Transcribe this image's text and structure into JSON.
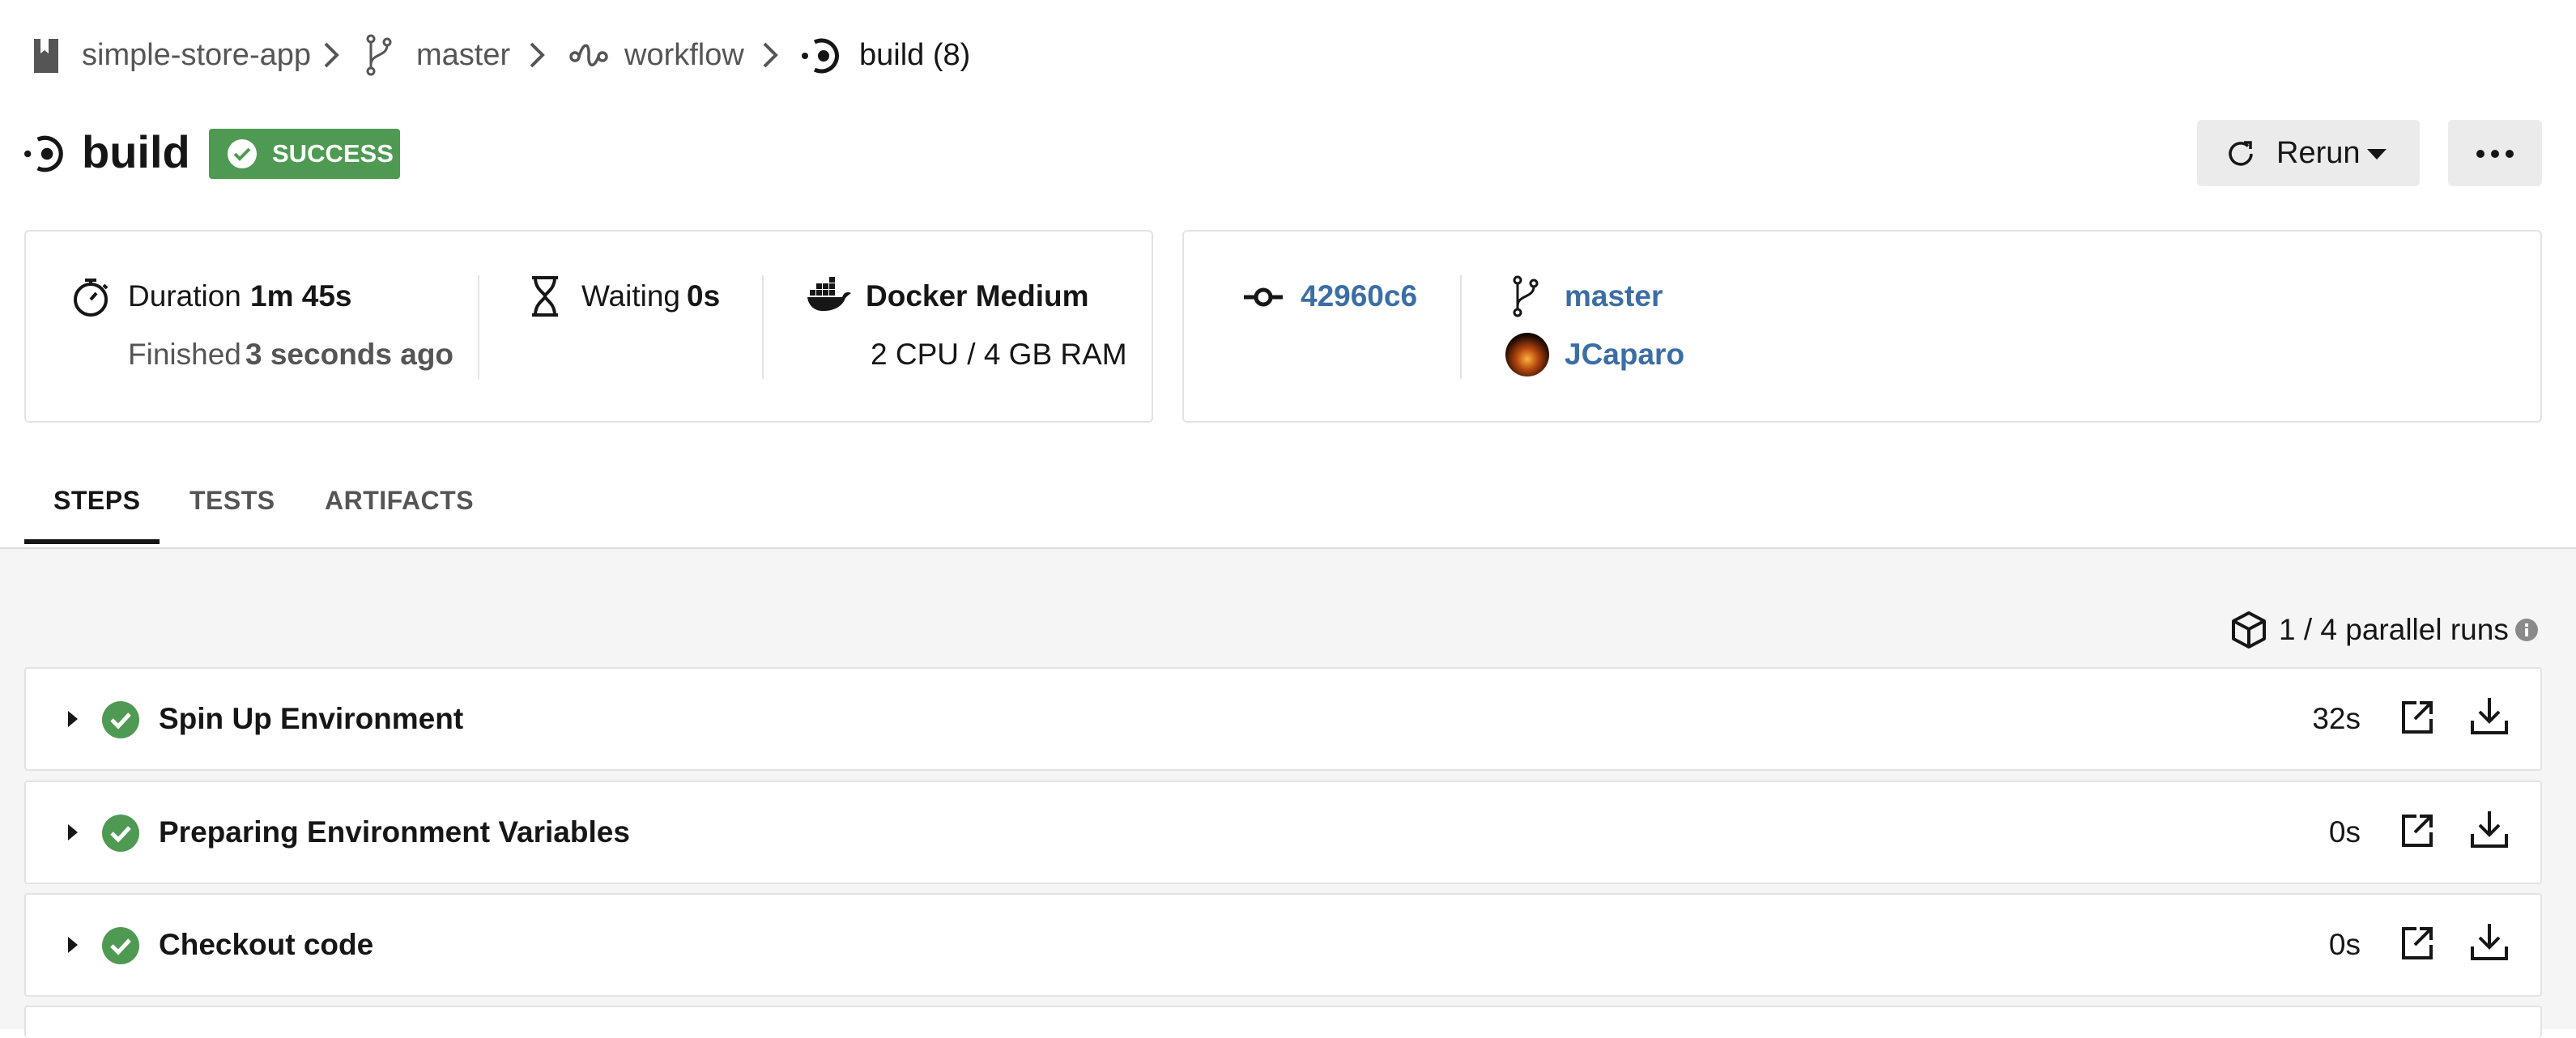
{
  "breadcrumb": {
    "project": "simple-store-app",
    "branch": "master",
    "workflow": "workflow",
    "job": "build (8)"
  },
  "header": {
    "title": "build",
    "status": "SUCCESS",
    "rerun_label": "Rerun"
  },
  "details": {
    "duration_label": "Duration",
    "duration_value": "1m 45s",
    "finished_label": "Finished",
    "finished_value": "3 seconds ago",
    "waiting_label": "Waiting",
    "waiting_value": "0s",
    "executor": "Docker Medium",
    "resources": "2 CPU / 4 GB RAM"
  },
  "commit": {
    "sha": "42960c6",
    "branch": "master",
    "author": "JCaparo"
  },
  "tabs": [
    {
      "label": "STEPS"
    },
    {
      "label": "TESTS"
    },
    {
      "label": "ARTIFACTS"
    }
  ],
  "parallel_runs": "1 / 4 parallel runs",
  "steps": [
    {
      "name": "Spin Up Environment",
      "duration": "32s"
    },
    {
      "name": "Preparing Environment Variables",
      "duration": "0s"
    },
    {
      "name": "Checkout code",
      "duration": "0s"
    }
  ],
  "colors": {
    "success": "#4e9a53",
    "link": "#3b6ea5"
  }
}
